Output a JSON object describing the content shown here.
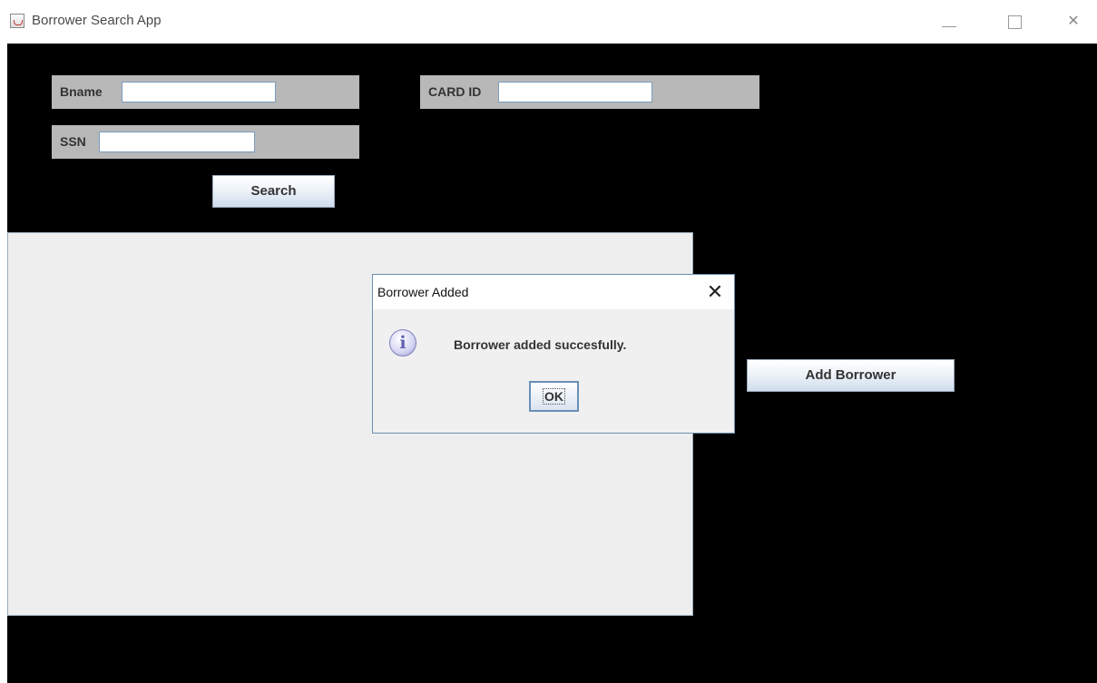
{
  "window": {
    "title": "Borrower Search App",
    "icon": "java-cup-icon",
    "close_glyph": "✕"
  },
  "search_form": {
    "bname_label": "Bname",
    "bname_value": "",
    "card_id_label": "CARD ID",
    "card_id_value": "",
    "ssn_label": "SSN",
    "ssn_value": "",
    "search_button": "Search"
  },
  "actions": {
    "add_borrower_button": "Add Borrower"
  },
  "dialog": {
    "title": "Borrower Added",
    "close_glyph": "✕",
    "icon": "info-icon",
    "icon_glyph": "i",
    "message": "Borrower added succesfully.",
    "ok_button": "OK"
  },
  "colors": {
    "background": "#000000",
    "panel": "#b8b8b8",
    "result_area": "#eeeeee",
    "dialog_border": "#6b8fb0"
  }
}
